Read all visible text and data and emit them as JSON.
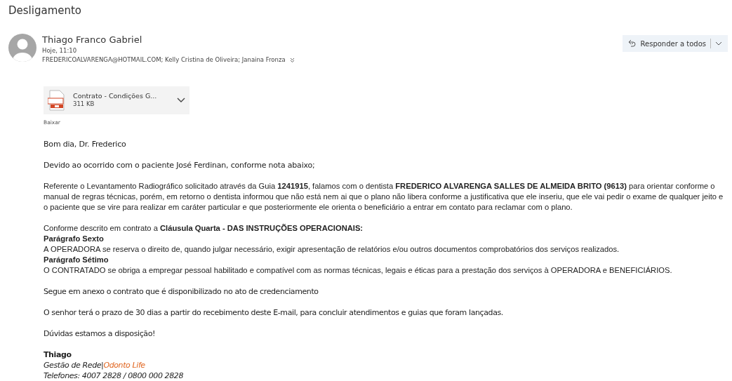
{
  "subject": "Desligamento",
  "sender": {
    "name": "Thiago Franco Gabriel",
    "time": "Hoje, 11:10",
    "recipients": "FREDERICOALVARENGA@HOTMAIL.COM; Kelly Cristina de Oliveira; Janaina Fronza",
    "expanded": false
  },
  "reply_button": {
    "label": "Responder a todos"
  },
  "attachment": {
    "name": "Contrato - Condições G...",
    "size": "311 KB",
    "action": "Baixar"
  },
  "body": [
    {
      "kind": "segoe",
      "lines": [
        {
          "kind": "text",
          "text": "Bom dia, Dr. Frederico"
        }
      ]
    },
    {
      "kind": "segoe",
      "lines": [
        {
          "kind": "text",
          "text": "Devido ao ocorrido com o paciente José Ferdinan, conforme nota abaixo;"
        }
      ]
    },
    {
      "kind": "arial",
      "lines": [
        {
          "kind": "text",
          "text": "Referente o Levantamento Radiográfico solicitado através da Guia **1241915**, falamos com o dentista **FREDERICO ALVARENGA SALLES DE ALMEIDA BRITO (9613)** para orientar conforme o manual de regras técnicas, porém, em retorno o dentista informou que não está nem ai que o plano não libera conforme a justificativa que ele inseriu, que ele vai pedir o exame de qualquer jeito e o paciente que se vire para realizar em caráter particular e que posteriormente ele orienta o beneficiário a entrar em contato para reclamar com o plano."
        }
      ]
    },
    {
      "kind": "arial",
      "lines": [
        {
          "kind": "text",
          "text": "Conforme descrito em contrato a  **Cláusula Quarta - DAS INSTRUÇÕES OPERACIONAIS:**"
        },
        {
          "kind": "heading",
          "text": "Parágrafo Sexto"
        },
        {
          "kind": "text",
          "text": "A OPERADORA se reserva o direito de, quando julgar necessário, exigir apresentação de relatórios e/ou outros documentos comprobatórios dos serviços realizados."
        },
        {
          "kind": "heading",
          "text": "Parágrafo Sétimo"
        },
        {
          "kind": "text",
          "text": "O CONTRATADO se obriga a empregar pessoal habilitado e compatível com as normas técnicas, legais e éticas para a prestação dos serviços à OPERADORA e BENEFICIÁRIOS."
        }
      ]
    },
    {
      "kind": "calibri",
      "lines": [
        {
          "kind": "text",
          "text": "Segue em anexo o contrato que é disponibilizado no ato de credenciamento"
        }
      ]
    },
    {
      "kind": "calibri",
      "lines": [
        {
          "kind": "text",
          "text": "O senhor terá o prazo de 30 dias a partir do recebimento deste E-mail, para concluir atendimentos e guias que foram lançadas."
        }
      ]
    },
    {
      "kind": "calibri",
      "lines": [
        {
          "kind": "text",
          "text": "Dúvidas estamos a disposição!"
        }
      ]
    }
  ],
  "signature": {
    "name": "Thiago",
    "role": "Gestão de Rede|",
    "company": "Odonto Life",
    "phones": "Telefones: 4007 2828 / 0800 000 2828"
  }
}
